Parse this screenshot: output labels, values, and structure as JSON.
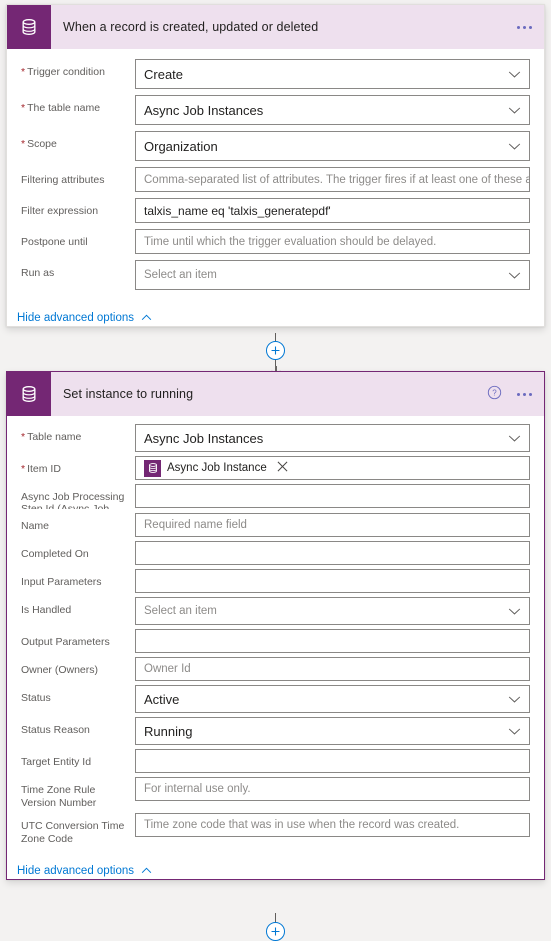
{
  "theme": {
    "accent_purple": "#742774",
    "header_bg": "#eee0ee",
    "link_blue": "#0078d4",
    "required_red": "#a4262c",
    "canvas_bg": "#f3f2f1"
  },
  "trigger_card": {
    "icon": "database-icon",
    "title": "When a record is created, updated or deleted",
    "menu_icon": "ellipsis-icon",
    "advanced_toggle": {
      "label": "Hide advanced options",
      "icon": "chevron-up-icon"
    },
    "fields": [
      {
        "label": "Trigger condition",
        "required": true,
        "type": "combo",
        "value": "Create",
        "placeholder": "",
        "icon": "chevron-down-icon"
      },
      {
        "label": "The table name",
        "required": true,
        "type": "combo",
        "value": "Async Job Instances",
        "placeholder": "",
        "icon": "chevron-down-icon"
      },
      {
        "label": "Scope",
        "required": true,
        "type": "combo",
        "value": "Organization",
        "placeholder": "",
        "icon": "chevron-down-icon"
      },
      {
        "label": "Filtering attributes",
        "required": false,
        "type": "text",
        "value": "",
        "placeholder": "Comma-separated list of attributes. The trigger fires if at least one of these attri"
      },
      {
        "label": "Filter expression",
        "required": false,
        "type": "text",
        "value": "talxis_name eq 'talxis_generatepdf'",
        "placeholder": ""
      },
      {
        "label": "Postpone until",
        "required": false,
        "type": "text",
        "value": "",
        "placeholder": "Time until which the trigger evaluation should be delayed."
      },
      {
        "label": "Run as",
        "required": false,
        "type": "combo",
        "value": "",
        "placeholder": "Select an item",
        "icon": "chevron-down-icon"
      }
    ]
  },
  "connector_top": {
    "add_button_icon": "plus-icon",
    "arrow_icon": "arrow-down-icon"
  },
  "action_card": {
    "icon": "database-icon",
    "title": "Set instance to running",
    "help_icon": "help-circle-icon",
    "menu_icon": "ellipsis-icon",
    "selected": true,
    "advanced_toggle": {
      "label": "Hide advanced options",
      "icon": "chevron-up-icon"
    },
    "fields": [
      {
        "label": "Table name",
        "required": true,
        "type": "combo",
        "value": "Async Job Instances",
        "placeholder": "",
        "icon": "chevron-down-icon"
      },
      {
        "label": "Item ID",
        "required": true,
        "type": "token",
        "token": {
          "icon": "database-icon",
          "label": "Async Job Instance",
          "remove_icon": "close-icon"
        }
      },
      {
        "label": "Async Job Processing Step Id (Async Job",
        "required": false,
        "type": "text",
        "value": "",
        "placeholder": ""
      },
      {
        "label": "Name",
        "required": false,
        "type": "text",
        "value": "",
        "placeholder": "Required name field"
      },
      {
        "label": "Completed On",
        "required": false,
        "type": "text",
        "value": "",
        "placeholder": ""
      },
      {
        "label": "Input Parameters",
        "required": false,
        "type": "text",
        "value": "",
        "placeholder": ""
      },
      {
        "label": "Is Handled",
        "required": false,
        "type": "combo",
        "value": "",
        "placeholder": "Select an item",
        "icon": "chevron-down-icon"
      },
      {
        "label": "Output Parameters",
        "required": false,
        "type": "text",
        "value": "",
        "placeholder": ""
      },
      {
        "label": "Owner (Owners)",
        "required": false,
        "type": "text",
        "value": "",
        "placeholder": "Owner Id"
      },
      {
        "label": "Status",
        "required": false,
        "type": "combo",
        "value": "Active",
        "placeholder": "",
        "icon": "chevron-down-icon"
      },
      {
        "label": "Status Reason",
        "required": false,
        "type": "combo",
        "value": "Running",
        "placeholder": "",
        "icon": "chevron-down-icon"
      },
      {
        "label": "Target Entity Id",
        "required": false,
        "type": "text",
        "value": "",
        "placeholder": ""
      },
      {
        "label": "Time Zone Rule Version Number",
        "required": false,
        "type": "text",
        "value": "",
        "placeholder": "For internal use only."
      },
      {
        "label": "UTC Conversion Time Zone Code",
        "required": false,
        "type": "text",
        "value": "",
        "placeholder": "Time zone code that was in use when the record was created."
      }
    ]
  },
  "connector_bottom": {
    "add_button_icon": "plus-icon"
  }
}
